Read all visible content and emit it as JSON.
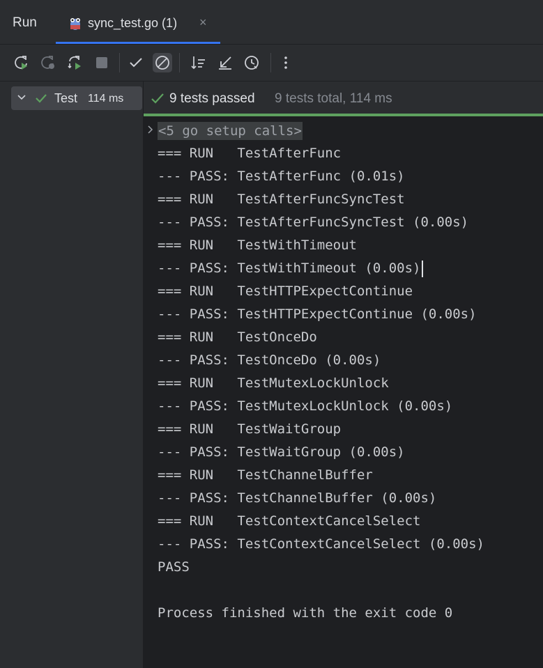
{
  "tabs": {
    "run_label": "Run",
    "file_label": "sync_test.go (1)",
    "close_symbol": "×"
  },
  "toolbar": {
    "icons": [
      "rerun-icon",
      "rerun-failed-icon",
      "rerun-toggle-icon",
      "stop-icon",
      "show-passed-icon",
      "show-ignored-icon",
      "sort-icon",
      "collapse-icon",
      "history-icon",
      "more-icon"
    ]
  },
  "tree": {
    "label": "Test",
    "duration": "114 ms"
  },
  "status": {
    "passed": "9 tests passed",
    "total": "9 tests total, 114 ms"
  },
  "console": {
    "setup_fold": "<5 go setup calls>",
    "lines": [
      "=== RUN   TestAfterFunc",
      "--- PASS: TestAfterFunc (0.01s)",
      "=== RUN   TestAfterFuncSyncTest",
      "--- PASS: TestAfterFuncSyncTest (0.00s)",
      "=== RUN   TestWithTimeout",
      "--- PASS: TestWithTimeout (0.00s)",
      "=== RUN   TestHTTPExpectContinue",
      "--- PASS: TestHTTPExpectContinue (0.00s)",
      "=== RUN   TestOnceDo",
      "--- PASS: TestOnceDo (0.00s)",
      "=== RUN   TestMutexLockUnlock",
      "--- PASS: TestMutexLockUnlock (0.00s)",
      "=== RUN   TestWaitGroup",
      "--- PASS: TestWaitGroup (0.00s)",
      "=== RUN   TestChannelBuffer",
      "--- PASS: TestChannelBuffer (0.00s)",
      "=== RUN   TestContextCancelSelect",
      "--- PASS: TestContextCancelSelect (0.00s)",
      "PASS",
      "",
      "Process finished with the exit code 0"
    ]
  },
  "colors": {
    "accent": "#3574f0",
    "success": "#5ea15f"
  }
}
